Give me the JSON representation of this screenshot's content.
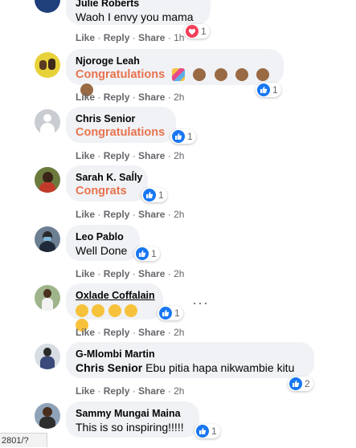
{
  "actions": {
    "like": "Like",
    "reply": "Reply",
    "share": "Share"
  },
  "comments": [
    {
      "name": "Julie Roberts",
      "text": "Waoh I envy you mama",
      "time": "1h",
      "reaction": "heart",
      "reaction_count": "1"
    },
    {
      "name": "Njoroge Leah",
      "text": "Congratulations",
      "emojis": [
        "confetti",
        "clap",
        "clap",
        "clap",
        "clap",
        "clap"
      ],
      "time": "2h",
      "reaction": "like",
      "reaction_count": "1"
    },
    {
      "name": "Chris Senior",
      "text": "Congratulations",
      "time": "2h",
      "reaction": "like",
      "reaction_count": "1"
    },
    {
      "name": "Sarah K. Saĺly",
      "text": "Congrats",
      "time": "2h",
      "reaction": "like",
      "reaction_count": "1"
    },
    {
      "name": "Leo Pablo",
      "text": "Well Done",
      "time": "2h",
      "reaction": "like",
      "reaction_count": "1"
    },
    {
      "name": "Oxlade Coffalain",
      "emojis": [
        "clap",
        "clap",
        "clap",
        "clap",
        "clap"
      ],
      "time": "2h",
      "reaction": "like",
      "reaction_count": "1"
    },
    {
      "name": "G-Mlombi Martin",
      "tag": "Chris Senior",
      "text": "Ebu pitia hapa nikwambie kitu",
      "time": "2h",
      "reaction": "like",
      "reaction_count": "2"
    },
    {
      "name": "Sammy Mungai Maina",
      "text": "This is so inspiring!!!!!",
      "reaction": "like",
      "reaction_count": "1"
    }
  ],
  "status_bar": {
    "url": "2801/?"
  },
  "colors": {
    "bubble": "#f0f2f5",
    "highlight": "#e9734e",
    "like_blue": "#1877f2",
    "heart_red": "#f33e58",
    "meta_gray": "#65676b"
  }
}
